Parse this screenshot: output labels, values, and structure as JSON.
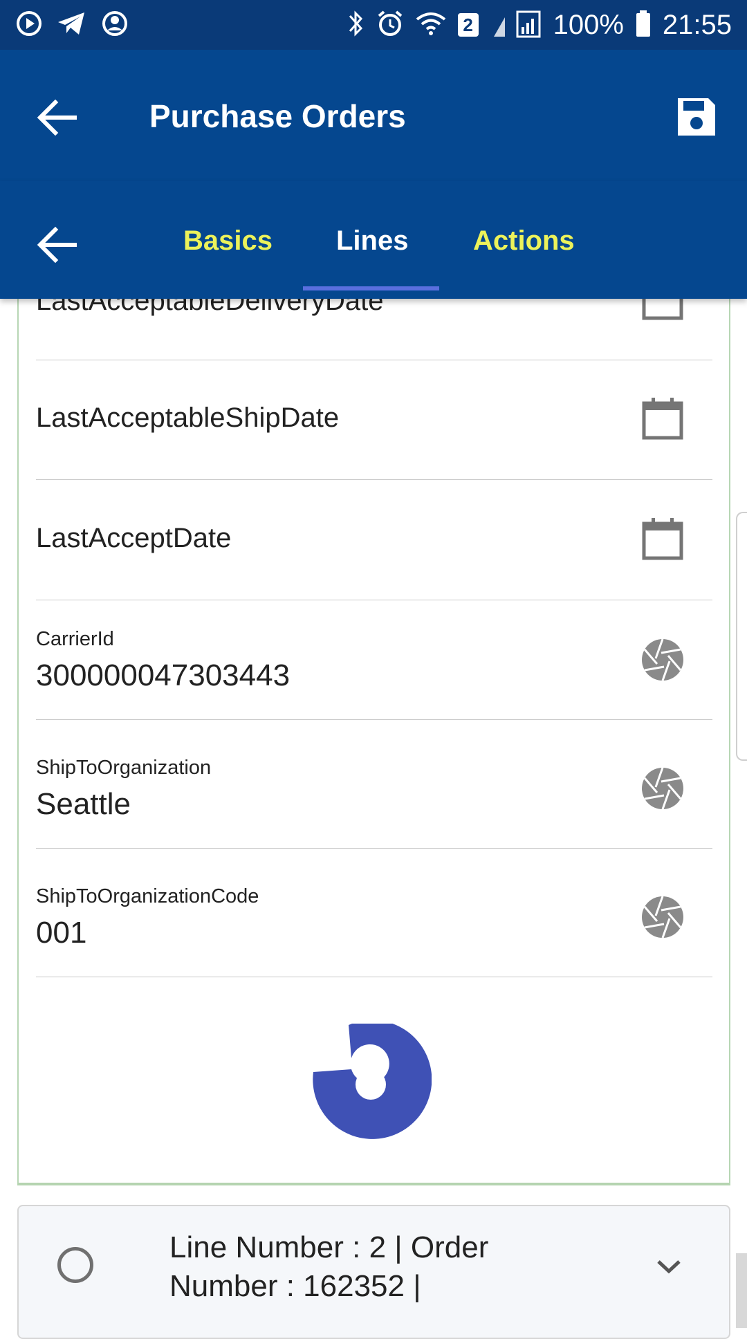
{
  "status_bar": {
    "battery": "100%",
    "time": "21:55",
    "sim_badge": "2",
    "icons": [
      "play-icon",
      "telegram-icon",
      "account-icon",
      "bluetooth-icon",
      "alarm-icon",
      "wifi-icon",
      "signal-icon",
      "battery-icon"
    ]
  },
  "app_bar": {
    "title": "Purchase Orders"
  },
  "tabs": [
    {
      "label": "Basics",
      "selected": false
    },
    {
      "label": "Lines",
      "selected": true
    },
    {
      "label": "Actions",
      "selected": false
    }
  ],
  "rows": [
    {
      "label": "LastAcceptableDeliveryDate",
      "icon": "calendar-icon"
    },
    {
      "label": "LastAcceptableShipDate",
      "icon": "calendar-icon"
    },
    {
      "label": "LastAcceptDate",
      "icon": "calendar-icon"
    },
    {
      "label": "CarrierId",
      "value": "300000047303443",
      "icon": "aperture-icon"
    },
    {
      "label": "ShipToOrganization",
      "value": "Seattle",
      "icon": "aperture-icon"
    },
    {
      "label": "ShipToOrganizationCode",
      "value": "001",
      "icon": "aperture-icon"
    }
  ],
  "bottom_item": {
    "text": "Line Number : 2 | Order Number : 162352 |"
  },
  "colors": {
    "status_bar": "#0a3a78",
    "app_bar": "#05478f",
    "tab_inactive": "#ecf25a",
    "tab_indicator": "#5a6fdf",
    "spinner": "#3f51b5",
    "card_border": "#b7d6b4"
  }
}
